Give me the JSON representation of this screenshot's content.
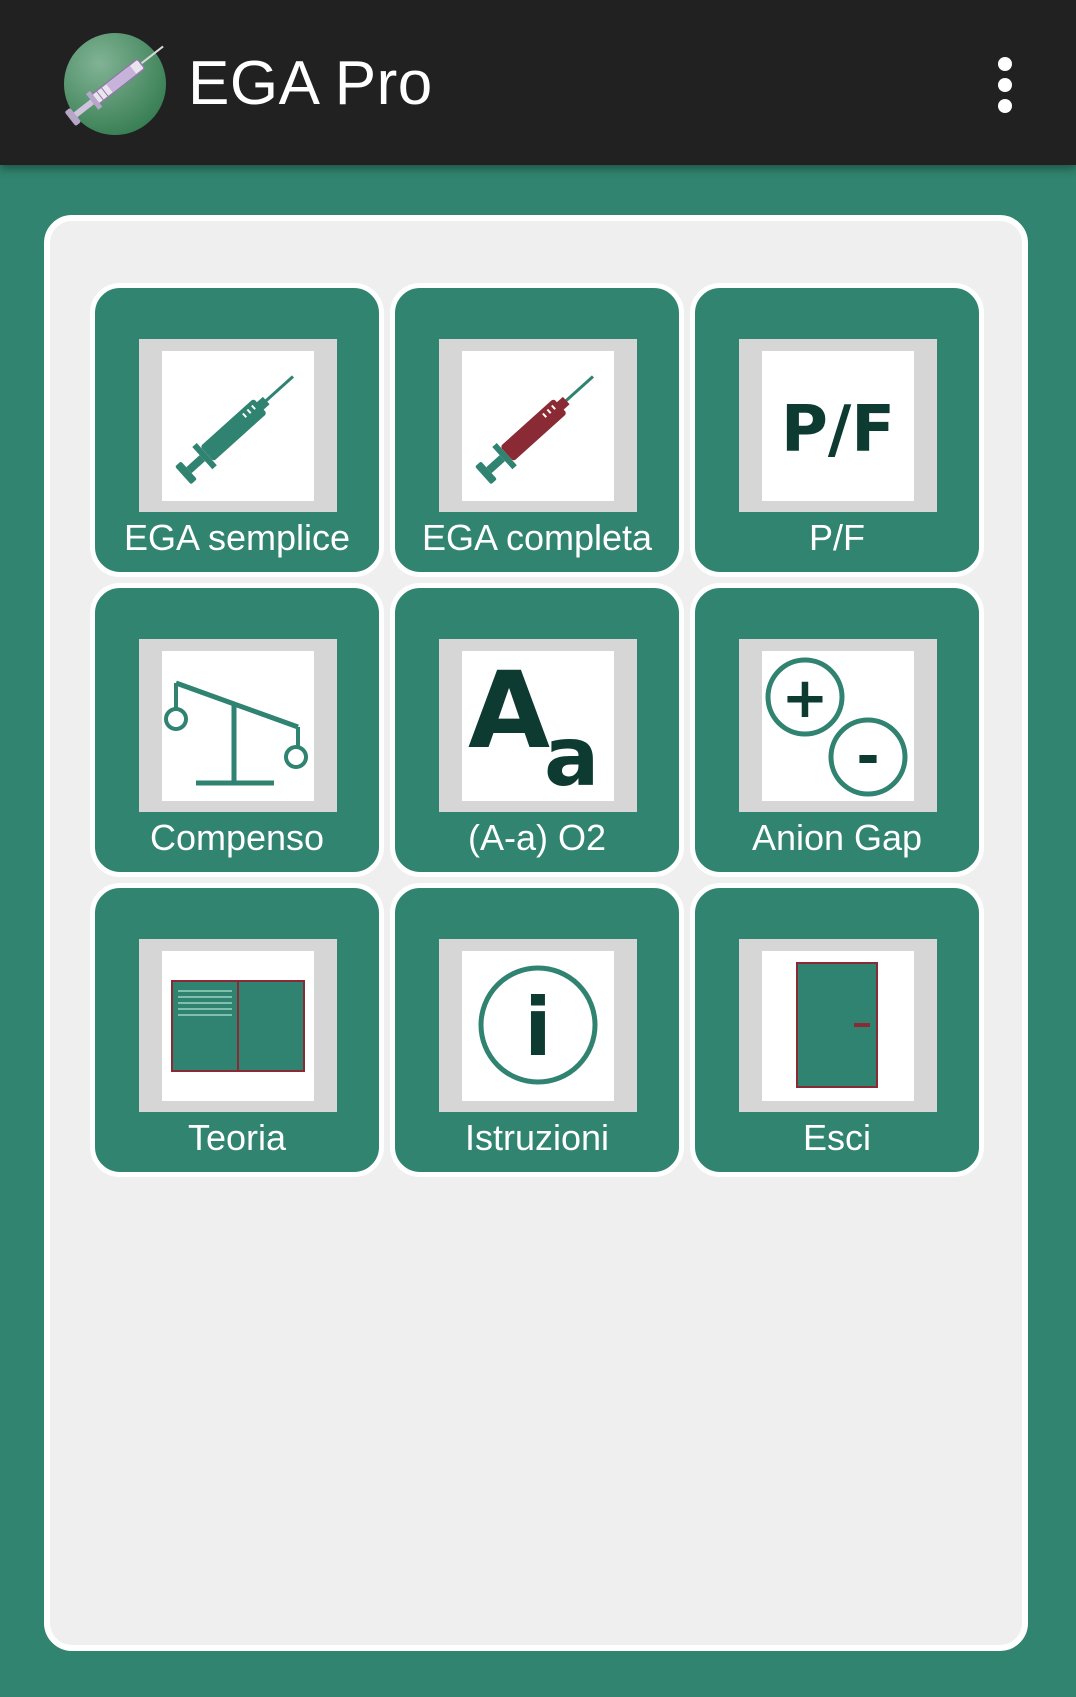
{
  "appbar": {
    "title": "EGA Pro",
    "logo_icon": "syringe-logo-icon",
    "menu_icon": "more-vert-icon"
  },
  "colors": {
    "appbar": "#212121",
    "background": "#31846f",
    "panel": "#efefef",
    "tile": "#31846f",
    "icon_teal": "#2f8370",
    "icon_red": "#8a2a34",
    "icon_dark": "#0d3b31"
  },
  "tiles": [
    {
      "label": "EGA semplice",
      "icon": "syringe-green-icon"
    },
    {
      "label": "EGA completa",
      "icon": "syringe-red-icon"
    },
    {
      "label": "P/F",
      "icon": "pf-text-icon",
      "icon_text": "P/F"
    },
    {
      "label": "Compenso",
      "icon": "balance-scale-icon"
    },
    {
      "label": "(A-a) O2",
      "icon": "font-aa-icon",
      "icon_text_big": "A",
      "icon_text_small": "a"
    },
    {
      "label": "Anion Gap",
      "icon": "plus-minus-icon",
      "plus": "+",
      "minus": "-"
    },
    {
      "label": "Teoria",
      "icon": "book-icon"
    },
    {
      "label": "Istruzioni",
      "icon": "info-icon",
      "icon_text": "i"
    },
    {
      "label": "Esci",
      "icon": "exit-door-icon"
    }
  ]
}
